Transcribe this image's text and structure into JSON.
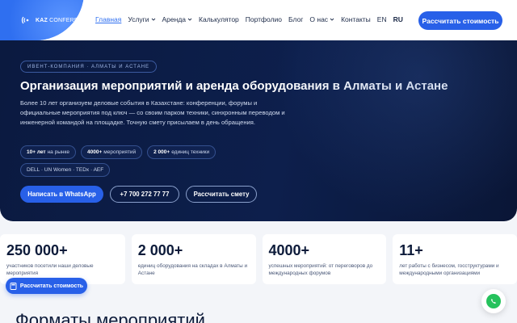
{
  "header": {
    "logo_brand": "KAZ",
    "logo_rest": "CONFERENCE",
    "nav": [
      {
        "label": "Главная",
        "active": true,
        "dropdown": false
      },
      {
        "label": "Услуги",
        "active": false,
        "dropdown": true
      },
      {
        "label": "Аренда",
        "active": false,
        "dropdown": true
      },
      {
        "label": "Калькулятор",
        "active": false,
        "dropdown": false
      },
      {
        "label": "Портфолио",
        "active": false,
        "dropdown": false
      },
      {
        "label": "Блог",
        "active": false,
        "dropdown": false
      },
      {
        "label": "О нас",
        "active": false,
        "dropdown": true
      },
      {
        "label": "Контакты",
        "active": false,
        "dropdown": false
      }
    ],
    "lang_en": "EN",
    "lang_ru": "RU",
    "cta_label": "Рассчитать стоимость"
  },
  "hero": {
    "eyebrow": "ИВЕНТ-КОМПАНИЯ · АЛМАТЫ И АСТАНЕ",
    "title": "Организация мероприятий и аренда оборудования в Алматы и Астане",
    "description": "Более 10 лет организуем деловые события в Казахстане: конференции, форумы и официальные мероприятия под ключ — со своим парком техники, синхронным переводом и инженерной командой на площадке. Точную смету присылаем в день обращения.",
    "chips": [
      {
        "bold": "10+ лет",
        "text": "на рынке"
      },
      {
        "bold": "4000+",
        "text": "мероприятий"
      },
      {
        "bold": "2 000+",
        "text": "единиц техники"
      }
    ],
    "clients_chip": "DELL · UN Women · TEDx · AEF",
    "btn_whatsapp": "Написать в WhatsApp",
    "btn_phone": "+7 700 272 77 77",
    "btn_estimate": "Рассчитать смету"
  },
  "stats": [
    {
      "number": "250 000+",
      "text": "участников посетили наши деловые мероприятия"
    },
    {
      "number": "2 000+",
      "text": "единиц оборудования на складах в Алматы и Астане"
    },
    {
      "number": "4000+",
      "text": "успешных мероприятий: от переговоров до международных форумов"
    },
    {
      "number": "11+",
      "text": "лет работы с бизнесом, госструктурами и международными организациями"
    }
  ],
  "floating_cta": "Рассчитать стоимость",
  "section_title": "Форматы мероприятий",
  "colors": {
    "accent": "#2860e8",
    "hero_bg": "#0b1a40",
    "whatsapp": "#25c25c"
  }
}
